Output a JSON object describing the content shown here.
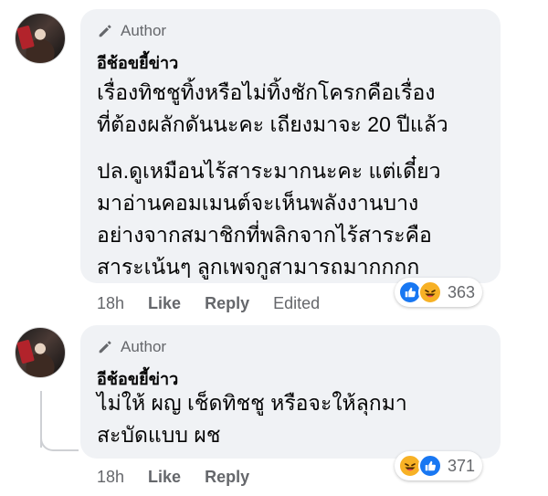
{
  "comments": [
    {
      "badge": "Author",
      "author": "อีช้อขยี้ข่าว",
      "paragraph1": [
        "เรื่องทิชชูทิ้งหรือไม่ทิ้งชักโครกคือเรื่อง",
        "ที่ต้องผลักดันนะคะ เถียงมาจะ 20 ปีแล้ว"
      ],
      "paragraph2": [
        "ปล.ดูเหมือนไร้สาระมากนะคะ แต่เดี๋ยว",
        "มาอ่านคอมเมนต์จะเห็นพลังงานบาง",
        "อย่างจากสมาชิกที่พลิกจากไร้สาระคือ",
        "สาระเน้นๆ ลูกเพจกูสามารถมากกกก"
      ],
      "time": "18h",
      "like_label": "Like",
      "reply_label": "Reply",
      "edited_label": "Edited",
      "reactions": [
        "like-icon",
        "haha-icon"
      ],
      "reaction_count": "363"
    },
    {
      "badge": "Author",
      "author": "อีช้อขยี้ข่าว",
      "lines": [
        "ไม่ให้ ผญ เช็ดทิชชู หรือจะให้ลุกมา",
        "สะบัดแบบ ผช"
      ],
      "time": "18h",
      "like_label": "Like",
      "reply_label": "Reply",
      "reactions": [
        "haha-icon",
        "like-icon"
      ],
      "reaction_count": "371"
    }
  ],
  "colors": {
    "bubble": "#f0f2f5",
    "meta_text": "#65676b",
    "like_blue": "#1877f2",
    "haha_yellow": "#f7b125"
  }
}
